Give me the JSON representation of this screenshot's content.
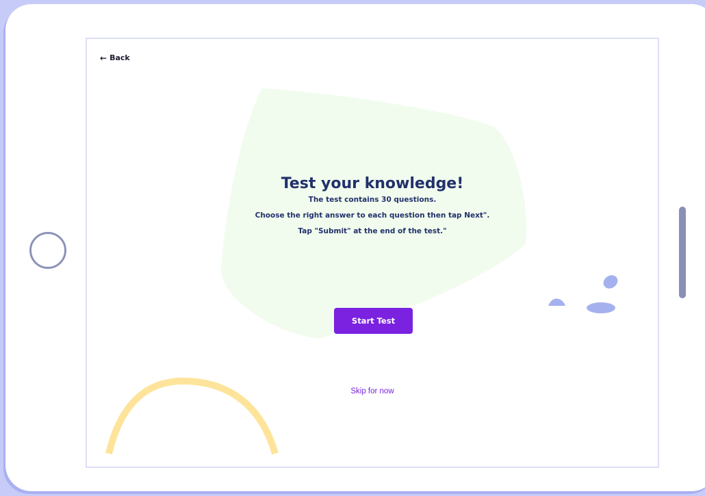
{
  "nav": {
    "back_label": "Back",
    "back_icon": "arrow-left-icon"
  },
  "intro": {
    "title": "Test your knowledge!",
    "line1": "The test contains 30 questions.",
    "line2": "Choose the right answer to each question then tap Next\".",
    "line3": "Tap \"Submit\" at the end of the test.\""
  },
  "actions": {
    "start_label": "Start Test",
    "skip_label": "Skip for now"
  },
  "colors": {
    "accent": "#7a22e0",
    "heading": "#22306b",
    "blob_green": "#f1fcee",
    "pebble_blue": "#a4b1ee",
    "arc_yellow": "#fde49a",
    "frame_background": "#c7cbf7"
  }
}
